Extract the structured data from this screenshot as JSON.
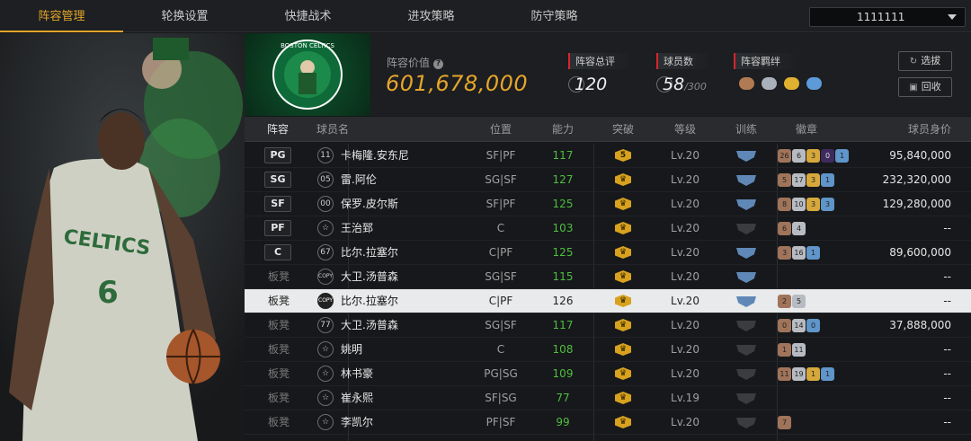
{
  "nav": {
    "tabs": [
      "阵容管理",
      "轮换设置",
      "快捷战术",
      "进攻策略",
      "防守策略"
    ],
    "active_index": 0,
    "team_select": "1111111"
  },
  "header": {
    "value_label": "阵容价值",
    "value": "601,678,000",
    "stats": [
      {
        "label": "阵容总评",
        "value": "120",
        "suffix": ""
      },
      {
        "label": "球员数",
        "value": "58",
        "suffix": "/300"
      },
      {
        "label": "阵容羁绊",
        "value": "",
        "suffix": ""
      }
    ],
    "buttons": {
      "pick": "选拔",
      "recycle": "回收"
    }
  },
  "table": {
    "headers": [
      "阵容",
      "球员名",
      "位置",
      "能力",
      "突破",
      "等级",
      "训练",
      "徽章",
      "球员身价"
    ],
    "rows": [
      {
        "slot": "PG",
        "no": "11",
        "name": "卡梅隆.安东尼",
        "pos": "SF|PF",
        "ability": "117",
        "break": "5",
        "level": "Lv.20",
        "train": true,
        "badges": [
          [
            "b-br",
            "26"
          ],
          [
            "b-si",
            "6"
          ],
          [
            "b-go",
            "3"
          ],
          [
            "b-pu",
            "0"
          ],
          [
            "b-bl",
            "1"
          ]
        ],
        "price": "95,840,000"
      },
      {
        "slot": "SG",
        "no": "05",
        "name": "雷.阿伦",
        "pos": "SG|SF",
        "ability": "127",
        "break": "",
        "level": "Lv.20",
        "train": true,
        "badges": [
          [
            "b-br",
            "5"
          ],
          [
            "b-si",
            "17"
          ],
          [
            "b-go",
            "3"
          ],
          [
            "b-bl",
            "1"
          ]
        ],
        "price": "232,320,000"
      },
      {
        "slot": "SF",
        "no": "00",
        "name": "保罗.皮尔斯",
        "pos": "SF|PF",
        "ability": "125",
        "break": "",
        "level": "Lv.20",
        "train": true,
        "badges": [
          [
            "b-br",
            "8"
          ],
          [
            "b-si",
            "10"
          ],
          [
            "b-go",
            "3"
          ],
          [
            "b-bl",
            "3"
          ]
        ],
        "price": "129,280,000"
      },
      {
        "slot": "PF",
        "no": "☆",
        "name": "王治郅",
        "pos": "C",
        "ability": "103",
        "break": "",
        "level": "Lv.20",
        "train": false,
        "badges": [
          [
            "b-br",
            "6"
          ],
          [
            "b-si",
            "4"
          ]
        ],
        "price": "--"
      },
      {
        "slot": "C",
        "no": "67",
        "name": "比尔.拉塞尔",
        "pos": "C|PF",
        "ability": "125",
        "break": "",
        "level": "Lv.20",
        "train": true,
        "badges": [
          [
            "b-br",
            "3"
          ],
          [
            "b-si",
            "16"
          ],
          [
            "b-bl",
            "1"
          ]
        ],
        "price": "89,600,000"
      },
      {
        "slot": "板凳",
        "no": "COPY",
        "name": "大卫.汤普森",
        "pos": "SG|SF",
        "ability": "115",
        "break": "",
        "level": "Lv.20",
        "train": true,
        "badges": [],
        "price": "--"
      },
      {
        "slot": "板凳",
        "no": "COPY",
        "name": "比尔.拉塞尔",
        "pos": "C|PF",
        "ability": "126",
        "break": "",
        "level": "Lv.20",
        "train": true,
        "badges": [
          [
            "b-br",
            "2"
          ],
          [
            "b-si",
            "5"
          ]
        ],
        "price": "--",
        "selected": true
      },
      {
        "slot": "板凳",
        "no": "77",
        "name": "大卫.汤普森",
        "pos": "SG|SF",
        "ability": "117",
        "break": "",
        "level": "Lv.20",
        "train": false,
        "badges": [
          [
            "b-br",
            "0"
          ],
          [
            "b-si",
            "14"
          ],
          [
            "b-bl",
            "0"
          ]
        ],
        "price": "37,888,000"
      },
      {
        "slot": "板凳",
        "no": "☆",
        "name": "姚明",
        "pos": "C",
        "ability": "108",
        "break": "",
        "level": "Lv.20",
        "train": false,
        "badges": [
          [
            "b-br",
            "1"
          ],
          [
            "b-si",
            "11"
          ]
        ],
        "price": "--"
      },
      {
        "slot": "板凳",
        "no": "☆",
        "name": "林书豪",
        "pos": "PG|SG",
        "ability": "109",
        "break": "",
        "level": "Lv.20",
        "train": false,
        "badges": [
          [
            "b-br",
            "11"
          ],
          [
            "b-si",
            "19"
          ],
          [
            "b-go",
            "1"
          ],
          [
            "b-bl",
            "1"
          ]
        ],
        "price": "--"
      },
      {
        "slot": "板凳",
        "no": "☆",
        "name": "崔永熙",
        "pos": "SF|SG",
        "ability": "77",
        "break": "",
        "level": "Lv.19",
        "train": false,
        "badges": [],
        "price": "--"
      },
      {
        "slot": "板凳",
        "no": "☆",
        "name": "李凯尔",
        "pos": "PF|SF",
        "ability": "99",
        "break": "",
        "level": "Lv.20",
        "train": false,
        "badges": [
          [
            "b-br",
            "7"
          ]
        ],
        "price": "--"
      }
    ]
  },
  "art": {
    "jersey_team": "CELTICS",
    "jersey_number": "6",
    "logo_text": "BOSTON CELTICS"
  }
}
